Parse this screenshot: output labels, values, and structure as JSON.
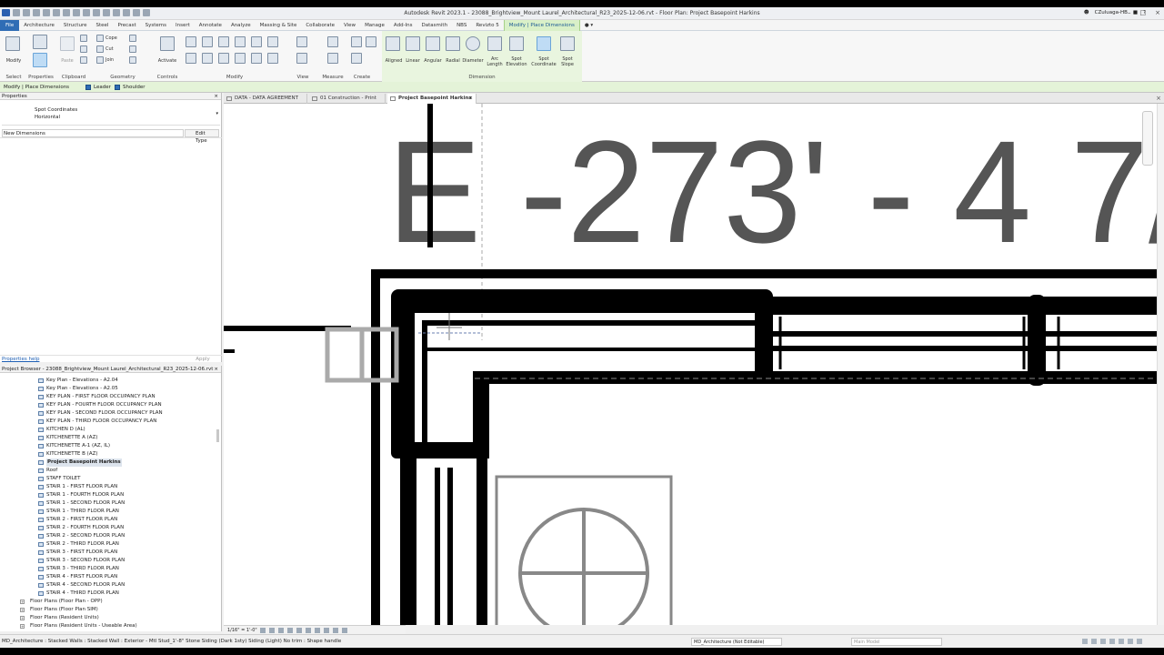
{
  "titlebar": {
    "title": "Autodesk Revit 2023.1 - 23088_Brightview_Mount Laurel_Architectural_R23_2025-12-06.rvt - Floor Plan: Project Basepoint Harkins",
    "user": "CZuluaga-HB"
  },
  "ribbon_tabs": [
    "File",
    "Architecture",
    "Structure",
    "Steel",
    "Precast",
    "Systems",
    "Insert",
    "Annotate",
    "Analyze",
    "Massing & Site",
    "Collaborate",
    "View",
    "Manage",
    "Add-Ins",
    "Datasmith",
    "NBS",
    "Revizto 5",
    "Modify | Place Dimensions"
  ],
  "ribbon": {
    "modify": "Modify",
    "paste": "Paste",
    "cope": "Cope",
    "cut": "Cut",
    "join": "Join",
    "activate": "Activate",
    "groups": [
      "Select",
      "Properties",
      "Clipboard",
      "Geometry",
      "Controls",
      "Modify",
      "View",
      "Measure",
      "Create",
      "Dimension"
    ],
    "dimension_tools": [
      "Aligned",
      "Linear",
      "Angular",
      "Radial",
      "Diameter",
      "Arc Length",
      "Spot Elevation",
      "Spot Coordinate",
      "Spot Slope"
    ]
  },
  "optbar": {
    "context": "Modify | Place Dimensions",
    "leader": "Leader",
    "shoulder": "Shoulder"
  },
  "properties": {
    "title": "Properties",
    "type_family": "Spot Coordinates",
    "type_name": "Horizontal",
    "filter": "New Dimensions",
    "edit_type": "Edit Type",
    "help": "Properties help",
    "apply": "Apply"
  },
  "browser": {
    "title": "Project Browser - 23088_Brightview_Mount Laurel_Architectural_R23_2025-12-06.rvt",
    "views": [
      "Key Plan - Elevations - A2.04",
      "Key Plan - Elevations - A2.05",
      "KEY PLAN - FIRST FLOOR OCCUPANCY PLAN",
      "KEY PLAN - FOURTH FLOOR OCCUPANCY PLAN",
      "KEY PLAN - SECOND FLOOR OCCUPANCY PLAN",
      "KEY PLAN - THIRD FLOOR OCCUPANCY PLAN",
      "KITCHEN D (AL)",
      "KITCHENETTE A (AZ)",
      "KITCHENETTE A-1 (AZ, IL)",
      "KITCHENETTE B (AZ)",
      "Project Basepoint Harkins",
      "Roof",
      "STAFF TOILET",
      "STAIR 1 - FIRST FLOOR PLAN",
      "STAIR 1 - FOURTH FLOOR PLAN",
      "STAIR 1 - SECOND FLOOR PLAN",
      "STAIR 1 - THIRD FLOOR PLAN",
      "STAIR 2 - FIRST FLOOR PLAN",
      "STAIR 2 - FOURTH FLOOR PLAN",
      "STAIR 2 - SECOND FLOOR PLAN",
      "STAIR 2 - THIRD FLOOR PLAN",
      "STAIR 3 - FIRST FLOOR PLAN",
      "STAIR 3 - SECOND FLOOR PLAN",
      "STAIR 3 - THIRD FLOOR PLAN",
      "STAIR 4 - FIRST FLOOR PLAN",
      "STAIR 4 - SECOND FLOOR PLAN",
      "STAIR 4 - THIRD FLOOR PLAN"
    ],
    "groups": [
      "Floor Plans (Floor Plan - OPP)",
      "Floor Plans (Floor Plan SIM)",
      "Floor Plans (Resident Units)",
      "Floor Plans (Resident Units - Useable Area)"
    ]
  },
  "view_tabs": [
    "DATA - DATA AGREEMENT",
    "01 Construction - Print",
    "Project Basepoint Harkins"
  ],
  "canvas": {
    "coordinate_text": "E -273' - 4 7/"
  },
  "view_control": {
    "scale": "1/16\" = 1'-0\""
  },
  "status": {
    "message": "MD_Architecture : Stacked Walls : Stacked Wall : Exterior - Mtl Stud_1'-8\" Stone Siding (Dark 1sty) Siding (Light) No trim : Shape handle",
    "workset": "MD_Architecture (Not Editable)",
    "design_option": "Main Model"
  },
  "colors": {
    "accent": "#2f6db5",
    "context_tab": "#d9f0c8",
    "option_bar": "#e4f3d8",
    "drawing_dark": "#555555"
  }
}
